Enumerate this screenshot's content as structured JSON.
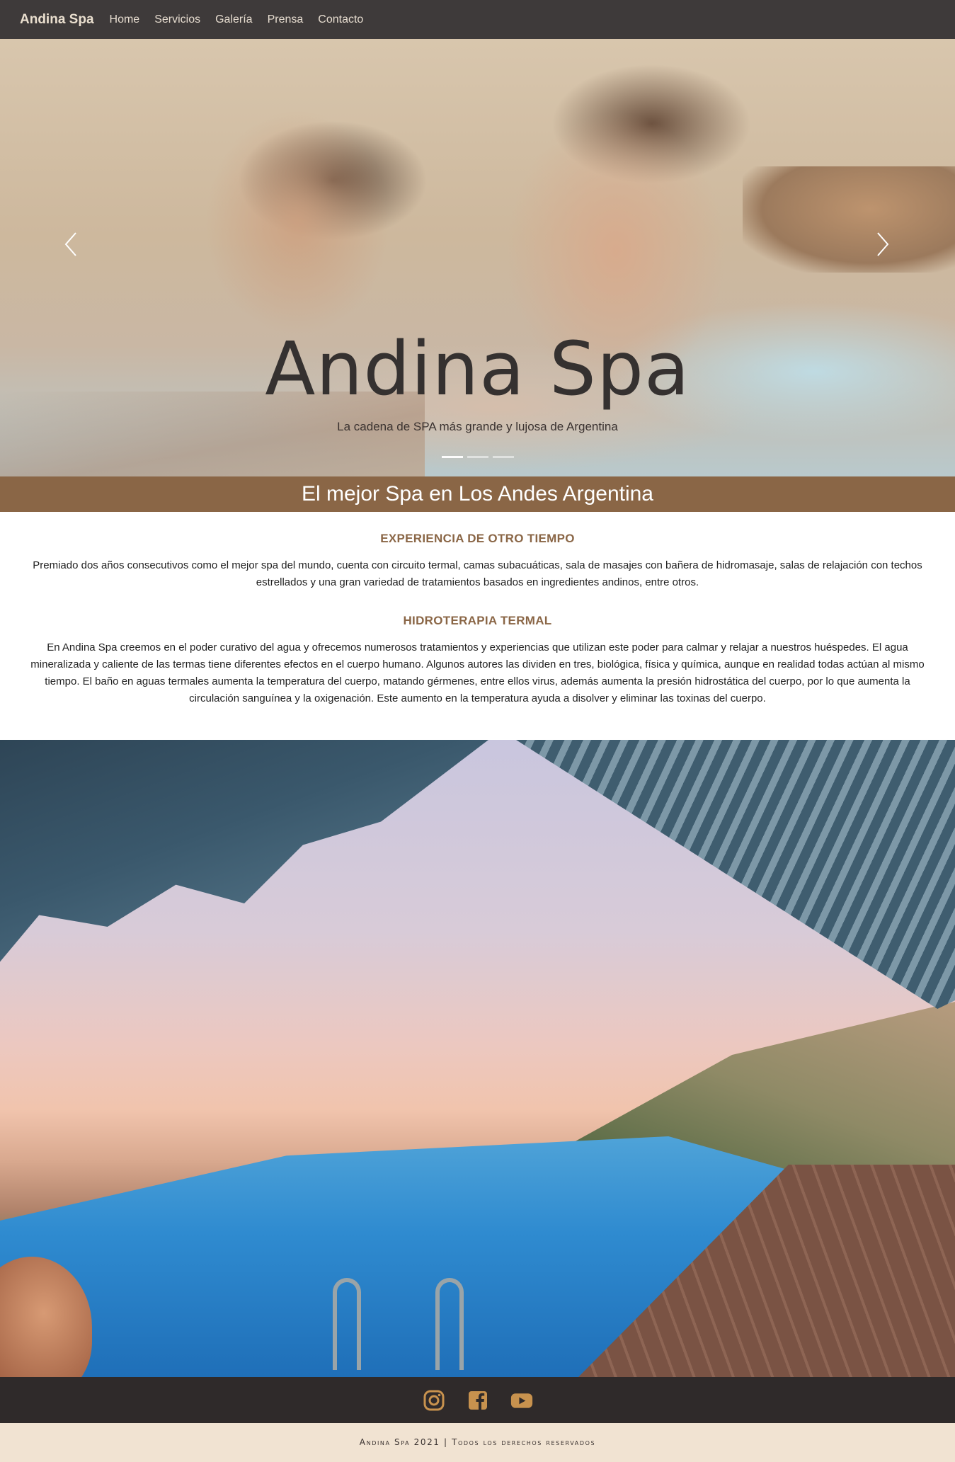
{
  "navbar": {
    "brand": "Andina Spa",
    "links": [
      "Home",
      "Servicios",
      "Galería",
      "Prensa",
      "Contacto"
    ]
  },
  "hero": {
    "title": "Andina Spa",
    "subtitle": "La cadena de SPA más grande y lujosa de Argentina",
    "prev_icon": "chevron-left-icon",
    "next_icon": "chevron-right-icon",
    "slides_count": 3,
    "active_slide": 1
  },
  "banner": {
    "text": "El mejor Spa en Los Andes Argentina"
  },
  "sections": [
    {
      "title": "EXPERIENCIA DE OTRO TIEMPO",
      "text": "Premiado dos años consecutivos como el mejor spa del mundo, cuenta con circuito termal, camas subacuáticas, sala de masajes con bañera de hidromasaje, salas de relajación con techos estrellados y una gran variedad de tratamientos basados en ingredientes andinos, entre otros."
    },
    {
      "title": "HIDROTERAPIA TERMAL",
      "text": "En Andina Spa creemos en el poder curativo del agua y ofrecemos numerosos tratamientos y experiencias que utilizan este poder para calmar y relajar a nuestros huéspedes. El agua mineralizada y caliente de las termas tiene diferentes efectos en el cuerpo humano. Algunos autores las dividen en tres, biológica, física y química, aunque en realidad todas actúan al mismo tiempo. El baño en aguas termales aumenta la temperatura del cuerpo, matando gérmenes, entre ellos virus, además aumenta la presión hidrostática del cuerpo, por lo que aumenta la circulación sanguínea y la oxigenación. Este aumento en la temperatura ayuda a disolver y eliminar las toxinas del cuerpo."
    }
  ],
  "footer": {
    "social_icons": [
      "instagram-icon",
      "facebook-icon",
      "youtube-icon"
    ],
    "icon_color": "#c8924e",
    "copyright": "Andina Spa 2021 | Todos los derechos reservados"
  },
  "colors": {
    "navbar_bg": "#3e3a3a",
    "accent_brown": "#8a6646",
    "footer_bg": "#2f2a2a",
    "copyright_bg": "#f1e3d2"
  }
}
